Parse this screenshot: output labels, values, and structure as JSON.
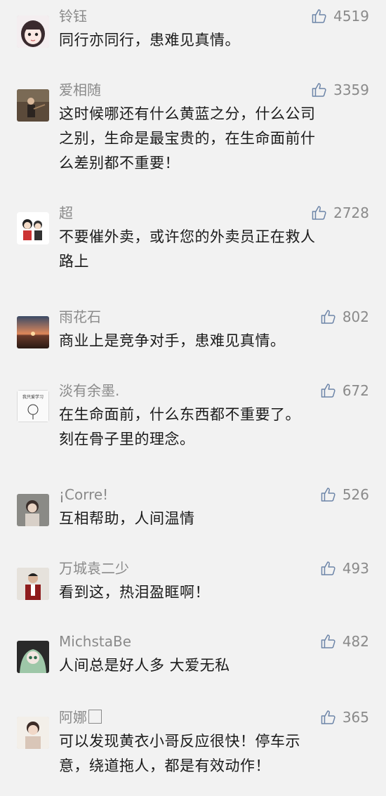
{
  "comments": [
    {
      "user": "铃钰",
      "likes": "4519",
      "lines": [
        "同行亦同行，患难见真情。"
      ]
    },
    {
      "user": "爱相随",
      "likes": "3359",
      "lines": [
        "这时候哪还有什么黄蓝之分，什么公司",
        "之别，生命是最宝贵的，在生命面前什",
        "么差别都不重要！"
      ]
    },
    {
      "user": "超",
      "likes": "2728",
      "lines": [
        "不要催外卖，或许您的外卖员正在救人",
        "路上"
      ]
    },
    {
      "user": "雨花石",
      "likes": "802",
      "lines": [
        "商业上是竞争对手，患难见真情。"
      ]
    },
    {
      "user": "淡有余墨.",
      "likes": "672",
      "lines": [
        "在生命面前，什么东西都不重要了。",
        "刻在骨子里的理念。"
      ]
    },
    {
      "user": "¡Corre!",
      "likes": "526",
      "lines": [
        "互相帮助，人间温情"
      ]
    },
    {
      "user": "万城袁二少",
      "likes": "493",
      "lines": [
        "看到这，热泪盈眶啊！"
      ]
    },
    {
      "user": "MichstaBe",
      "likes": "482",
      "lines": [
        "人间总是好人多 大爱无私"
      ]
    },
    {
      "user": "阿娜",
      "likes": "365",
      "lines": [
        "可以发现黄衣小哥反应很快！停车示",
        "意，绕道拖人，都是有效动作！"
      ]
    }
  ],
  "avatar_texts": {
    "c4": "我只爱学习"
  },
  "icons": {
    "like": "thumbs-up-icon"
  }
}
